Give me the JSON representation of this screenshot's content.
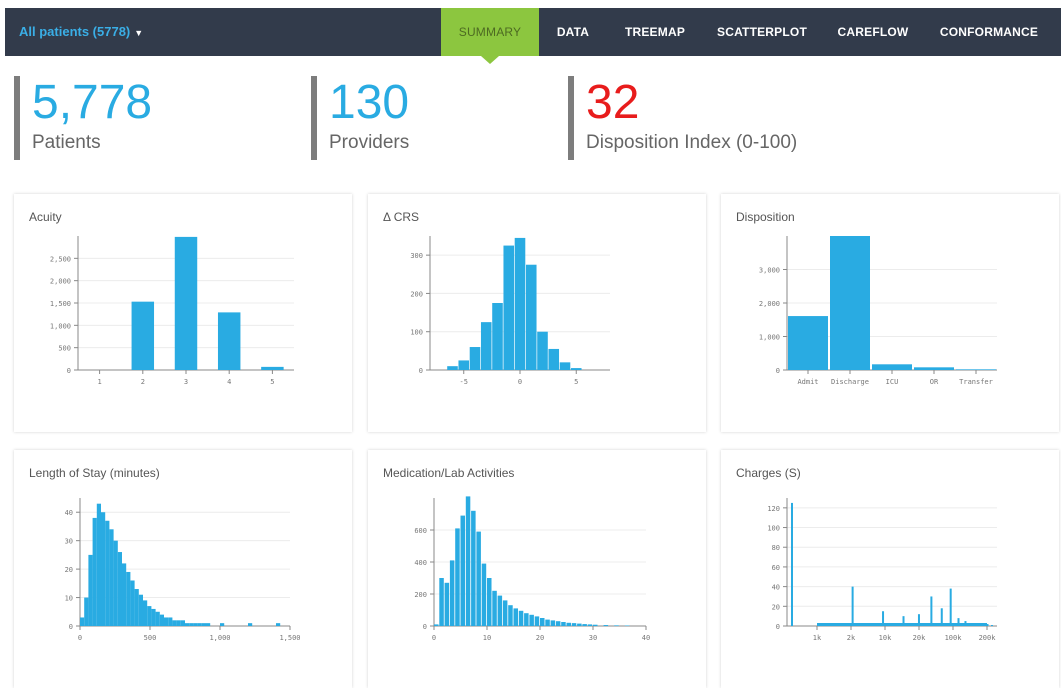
{
  "cohort": {
    "label": "All patients (5778)"
  },
  "tabs": [
    {
      "label": "SUMMARY",
      "active": true
    },
    {
      "label": "DATA"
    },
    {
      "label": "TREEMAP"
    },
    {
      "label": "SCATTERPLOT"
    },
    {
      "label": "CAREFLOW"
    },
    {
      "label": "CONFORMANCE"
    }
  ],
  "kpis": {
    "patients": {
      "value": "5,778",
      "label": "Patients"
    },
    "providers": {
      "value": "130",
      "label": "Providers"
    },
    "disposition": {
      "value": "32",
      "label": "Disposition Index (0-100)"
    }
  },
  "colors": {
    "bar": "#29abe2",
    "topbar": "#323b4b",
    "active_tab": "#8cc63f",
    "alert": "#e81c1c"
  },
  "chart_data": [
    {
      "type": "bar",
      "title": "Acuity",
      "categories": [
        "1",
        "2",
        "3",
        "4",
        "5"
      ],
      "values": [
        0,
        1530,
        2980,
        1290,
        70
      ],
      "ylim": [
        0,
        3000
      ],
      "yticks": [
        "0",
        "500",
        "1,000",
        "1,500",
        "2,000",
        "2,500"
      ]
    },
    {
      "type": "bar",
      "title": "Δ CRS",
      "x": [
        -6,
        -5,
        -4,
        -3,
        -2,
        -1,
        0,
        1,
        2,
        3,
        4,
        5
      ],
      "values": [
        10,
        25,
        60,
        125,
        175,
        325,
        345,
        275,
        100,
        55,
        20,
        5
      ],
      "xlim": [
        -8,
        8
      ],
      "ylim": [
        0,
        350
      ],
      "xticks": [
        "-5",
        "0",
        "5"
      ],
      "yticks": [
        "0",
        "100",
        "200",
        "300"
      ]
    },
    {
      "type": "bar",
      "title": "Disposition",
      "categories": [
        "Admit",
        "Discharge",
        "ICU",
        "OR",
        "Transfer"
      ],
      "values": [
        1610,
        4000,
        170,
        80,
        20
      ],
      "ylim": [
        0,
        4000
      ],
      "yticks": [
        "0",
        "1,000",
        "2,000",
        "3,000"
      ]
    },
    {
      "type": "bar",
      "title": "Length of Stay (minutes)",
      "x": [
        0,
        30,
        60,
        90,
        120,
        150,
        180,
        210,
        240,
        270,
        300,
        330,
        360,
        390,
        420,
        450,
        480,
        510,
        540,
        570,
        600,
        630,
        660,
        690,
        720,
        750,
        780,
        810,
        840,
        870,
        900,
        1000,
        1200,
        1400
      ],
      "values": [
        3,
        10,
        25,
        38,
        43,
        40,
        37,
        34,
        30,
        26,
        22,
        19,
        16,
        13,
        11,
        9,
        7,
        6,
        5,
        4,
        3,
        3,
        2,
        2,
        2,
        1,
        1,
        1,
        1,
        1,
        1,
        1,
        1,
        1
      ],
      "xlim": [
        0,
        1500
      ],
      "ylim": [
        0,
        45
      ],
      "xticks": [
        "0",
        "500",
        "1,000",
        "1,500"
      ],
      "yticks": [
        "0",
        "10",
        "20",
        "30",
        "40"
      ]
    },
    {
      "type": "bar",
      "title": "Medication/Lab Activities",
      "x": [
        0,
        1,
        2,
        3,
        4,
        5,
        6,
        7,
        8,
        9,
        10,
        11,
        12,
        13,
        14,
        15,
        16,
        17,
        18,
        19,
        20,
        21,
        22,
        23,
        24,
        25,
        26,
        27,
        28,
        29,
        30,
        32,
        34,
        36
      ],
      "values": [
        10,
        300,
        270,
        410,
        610,
        690,
        810,
        720,
        590,
        390,
        300,
        220,
        190,
        160,
        130,
        110,
        95,
        80,
        70,
        60,
        50,
        40,
        35,
        30,
        25,
        20,
        18,
        15,
        12,
        10,
        8,
        6,
        4,
        3
      ],
      "xlim": [
        0,
        40
      ],
      "ylim": [
        0,
        800
      ],
      "xticks": [
        "0",
        "10",
        "20",
        "30",
        "40"
      ],
      "yticks": [
        "0",
        "200",
        "400",
        "600"
      ]
    },
    {
      "type": "bar",
      "title": "Charges (S)",
      "x": [
        "1",
        "2",
        "3",
        "4",
        "5",
        "7",
        "10",
        "15",
        "20",
        "30",
        "50",
        "100",
        "200",
        "1000",
        "2000"
      ],
      "values": [
        125,
        40,
        15,
        10,
        12,
        30,
        18,
        38,
        8,
        5,
        3,
        3,
        2,
        2,
        1
      ],
      "ylim": [
        0,
        130
      ],
      "xticks": [
        "1k",
        "2k",
        "10k",
        "20k",
        "100k",
        "200k"
      ],
      "yticks": [
        "0",
        "20",
        "40",
        "60",
        "80",
        "100",
        "120"
      ]
    }
  ]
}
